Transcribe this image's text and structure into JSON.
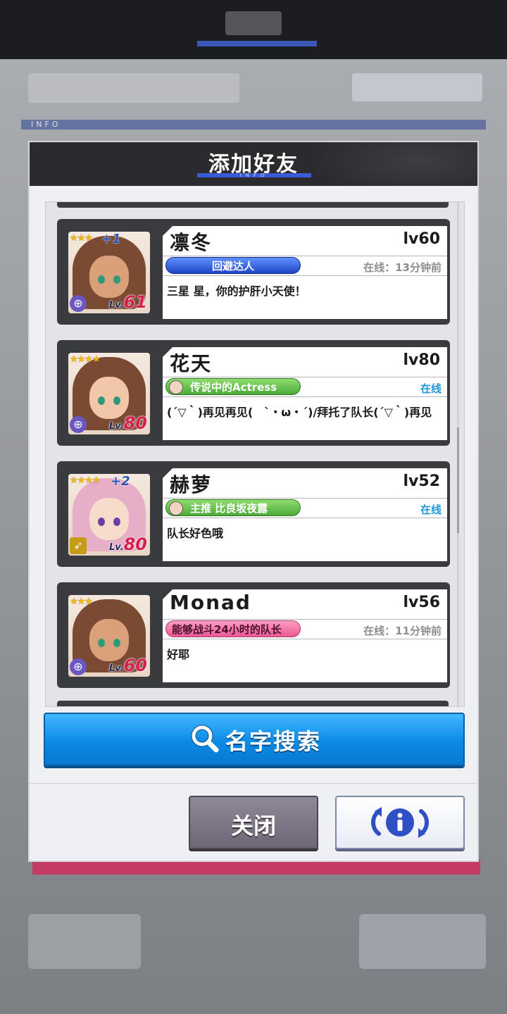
{
  "dialog": {
    "title": "添加好友",
    "title_sub": "INFO",
    "info_strip": "INFO"
  },
  "friends": [
    {
      "name": "凛冬",
      "level": "lv60",
      "badge": "回避达人",
      "badge_style": "blue",
      "status": "在线：13分钟前",
      "online": false,
      "comment": "三星 星，你的护肝小天使！",
      "avatar": {
        "stars": "★★★",
        "plus": "+1",
        "lv_prefix": "Lv.",
        "lv": "61",
        "class_icon": "crosshair-icon",
        "hair": "#7a4a32",
        "skin": "#d9a07a",
        "eye": "#2e9a7a"
      }
    },
    {
      "name": "花天",
      "level": "lv80",
      "badge": "传说中的Actress",
      "badge_style": "green",
      "status": "在线",
      "online": true,
      "comment": "(´▽｀)再见再见(　`・ω・´)/拜托了队长(´▽｀)再见",
      "avatar": {
        "stars": "★★★★",
        "plus": "",
        "lv_prefix": "Lv.",
        "lv": "80",
        "class_icon": "crosshair-icon",
        "hair": "#7a4a32",
        "skin": "#f1c7a8",
        "eye": "#2e9a7a"
      }
    },
    {
      "name": "赫萝",
      "level": "lv52",
      "badge": "主推 比良坂夜露",
      "badge_style": "green",
      "status": "在线",
      "online": true,
      "comment": "队长好色哦",
      "avatar": {
        "stars": "★★★★",
        "plus": "+2",
        "lv_prefix": "Lv.",
        "lv": "80",
        "class_icon": "rifle-icon",
        "hair": "#e7aec8",
        "skin": "#f7dccb",
        "eye": "#6a3fa0"
      }
    },
    {
      "name": "Monad",
      "level": "lv56",
      "badge": "能够战斗24小时的队长",
      "badge_style": "pink",
      "status": "在线：11分钟前",
      "online": false,
      "comment": "好耶",
      "avatar": {
        "stars": "★★★",
        "plus": "",
        "lv_prefix": "Lv.",
        "lv": "60",
        "class_icon": "crosshair-icon",
        "hair": "#7a4a32",
        "skin": "#d9a07a",
        "eye": "#2e9a7a"
      }
    }
  ],
  "search": {
    "label": "名字搜索",
    "icon": "search-icon"
  },
  "buttons": {
    "close_label": "关闭",
    "refresh_icon": "refresh-info-icon"
  },
  "colors": {
    "accent_blue": "#0b8ae6",
    "online": "#1e96d9",
    "level_red": "#d51f4f"
  }
}
